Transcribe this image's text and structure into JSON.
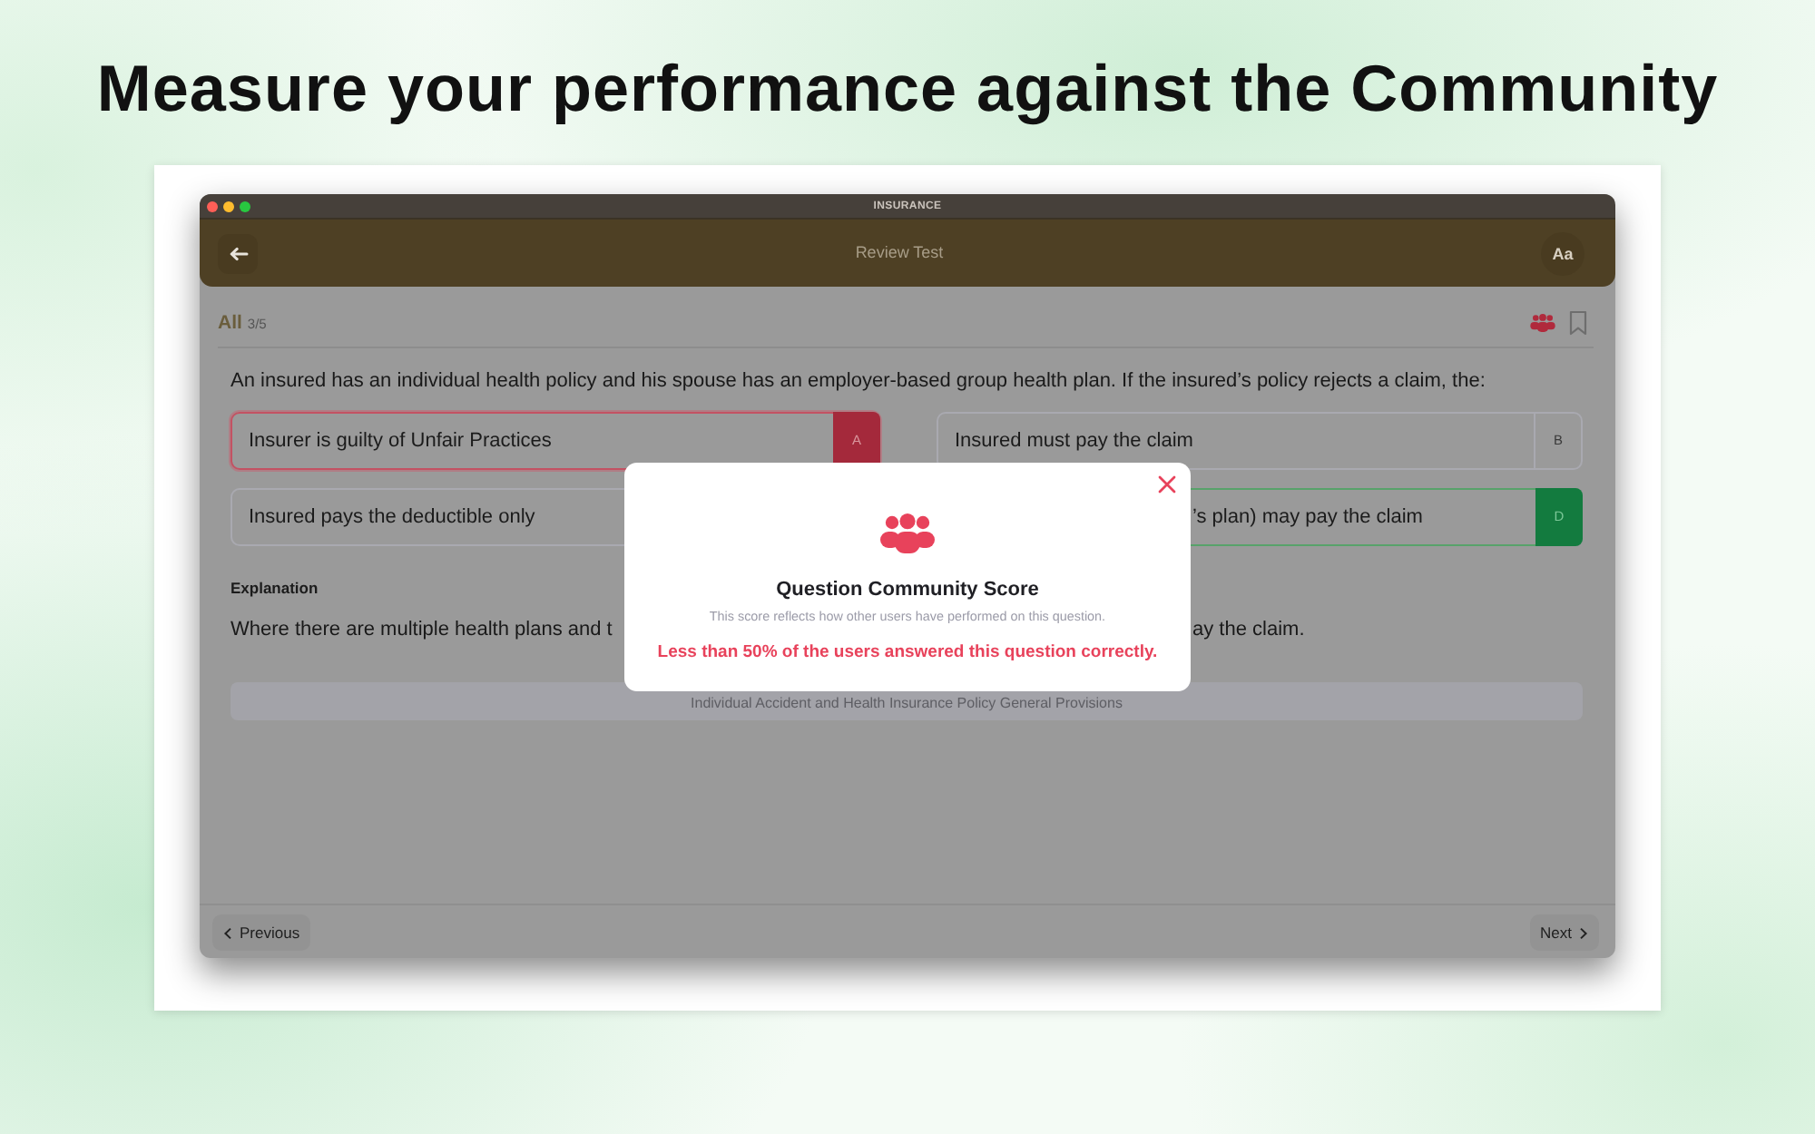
{
  "heading": "Measure your performance against the Community",
  "window": {
    "title": "INSURANCE"
  },
  "toolbar": {
    "title": "Review Test",
    "font_button": "Aa"
  },
  "filter": {
    "label": "All",
    "count": "3/5"
  },
  "question": "An insured has an individual health policy and his spouse has an employer-based group health plan. If the insured’s policy rejects a claim, the:",
  "options": [
    {
      "text": "Insurer is guilty of Unfair Practices",
      "letter": "A",
      "selected": true,
      "correct": false
    },
    {
      "text": "Insured must pay the claim",
      "letter": "B",
      "selected": false,
      "correct": false
    },
    {
      "text": "Insured pays the deductible only",
      "selected": false,
      "correct": false
    },
    {
      "text": "’s plan) may pay the claim",
      "letter": "D",
      "selected": false,
      "correct": true
    }
  ],
  "explanation": {
    "label": "Explanation",
    "text_parts": [
      "Where there are multiple health plans and t",
      "ay the claim."
    ]
  },
  "reference": "Individual Accident and Health Insurance Policy General Provisions",
  "navigation": {
    "previous": "Previous",
    "next": "Next"
  },
  "dialog": {
    "title": "Question Community Score",
    "subtitle": "This score reflects how other users have performed on this question.",
    "message": "Less than 50% of the users answered this question correctly."
  }
}
